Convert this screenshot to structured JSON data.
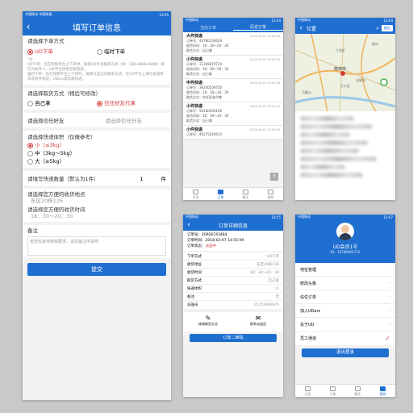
{
  "phone1": {
    "status": {
      "left": "中国移动 中国联通",
      "right": "12:05"
    },
    "title": "填写订单信息",
    "order_type": {
      "label": "请选择下单方式",
      "opt1": "UD下单",
      "opt2": "临时下单",
      "note_title": "*注",
      "note1": "UD下单：您在购物平台上下单时，请将UD平台联系方式（如：188-8888-8888）填写为收件人，UD平台将帮您取快递。",
      "note2": "临时下单：您在购物平台上下单时，请填写自己的联系方式，在UD平台上填写快递单号及收件电话，UDers帮您取快递。"
    },
    "pickup": {
      "label": "请选择取货方式（稍后可修改）",
      "opt1": "自己拿",
      "opt2": "信任好友代拿"
    },
    "friend": {
      "label": "请选择信任好友",
      "placeholder": "请选择信任好友"
    },
    "size": {
      "label": "请选择快递体积（仅做参考）",
      "small": "小（≤3kg）",
      "medium": "中（3kg～5kg）",
      "large": "大（≥5kg）"
    },
    "qty": {
      "label": "请填写快递数量（默认为1件）",
      "value": "1",
      "unit": "件"
    },
    "addr": {
      "label": "请选择您方便的收货地点",
      "value": "东区20栋126"
    },
    "time": {
      "label": "请选择您方便的收货时间",
      "value": "18：30～20：30"
    },
    "remark": {
      "label": "备注",
      "placeholder": "若您有其他特殊要求，请在备注中说明"
    },
    "submit": "提交"
  },
  "phone2": {
    "status": {
      "left": "中国移动",
      "right": "12:04"
    },
    "tabs": [
      "当前订单",
      "历史订单"
    ],
    "orders": [
      {
        "name": "大件快递",
        "time": "2018-03-07 14:00:16",
        "no": "订单号：44780230629",
        "t": "收货时间：18：30～20：30",
        "way": "取货方式：自己拿"
      },
      {
        "name": "小件快递",
        "time": "2018-03-07 13:47:30",
        "no": "订单号：31268979719",
        "t": "收货时间：18：30～20：30",
        "way": "取货方式：自己拿"
      },
      {
        "name": "中件快递",
        "time": "2018-03-07 13:41:28",
        "no": "订单号：39240509756",
        "t": "收货时间：18：30～20：30",
        "way": "取货方式：信任好友代拿"
      },
      {
        "name": "小件快递",
        "time": "2018-03-07 13:35:42",
        "no": "订单号：56180204166",
        "t": "收货时间：18：30～20：30",
        "way": "取货方式：自己拿"
      },
      {
        "name": "小件快递",
        "time": "2018-03-07 13:20:03",
        "no": "订单号：46275026914",
        "t": "",
        "way": ""
      }
    ],
    "tabbar": [
      "主页",
      "订单",
      "聊天",
      "我的"
    ]
  },
  "phone3": {
    "status": {
      "left": "中国移动",
      "right": "12:04"
    },
    "title": "位置",
    "confirm": "确定",
    "map_labels": {
      "city": "南京市",
      "a": "句容市",
      "b": "马鞍山",
      "c": "六合区",
      "d": "江宁区",
      "e": "扬州"
    }
  },
  "phone4": {
    "status": {
      "left": "中国移动",
      "right": "14:55"
    },
    "title": "订单详细信息",
    "order_no": "订单号：20926743484",
    "order_time": "订单时间：2018-03-07 14:55:09",
    "order_state_label": "订单状态：",
    "order_state": "派送中",
    "rows": [
      {
        "k": "下单方式",
        "v": "UD下单"
      },
      {
        "k": "收货地址",
        "v": "东区20栋126"
      },
      {
        "k": "收货时间",
        "v": "18：30～20：30"
      },
      {
        "k": "取货方式",
        "v": "自己拿"
      },
      {
        "k": "快递体积",
        "v": "小"
      },
      {
        "k": "备注",
        "v": "无"
      },
      {
        "k": "派送员",
        "v": "15753896876"
      }
    ],
    "btn_edit": "修改取货方式",
    "btn_contact": "联系派送员",
    "qr": "订单二维码"
  },
  "phone5": {
    "status": {
      "left": "中国移动",
      "right": "12:07"
    },
    "name": "UD会员1号",
    "id": "ID：18796905276",
    "menu": [
      "地址管理",
      "修改头像",
      "信任订单",
      "加入UDers",
      "关于UD",
      "员工通道"
    ],
    "logout": "退出登录",
    "tabbar": [
      "主页",
      "订单",
      "聊天",
      "我的"
    ]
  },
  "colors": {
    "primary": "#1f6fd1",
    "accent": "#d43c3c"
  }
}
